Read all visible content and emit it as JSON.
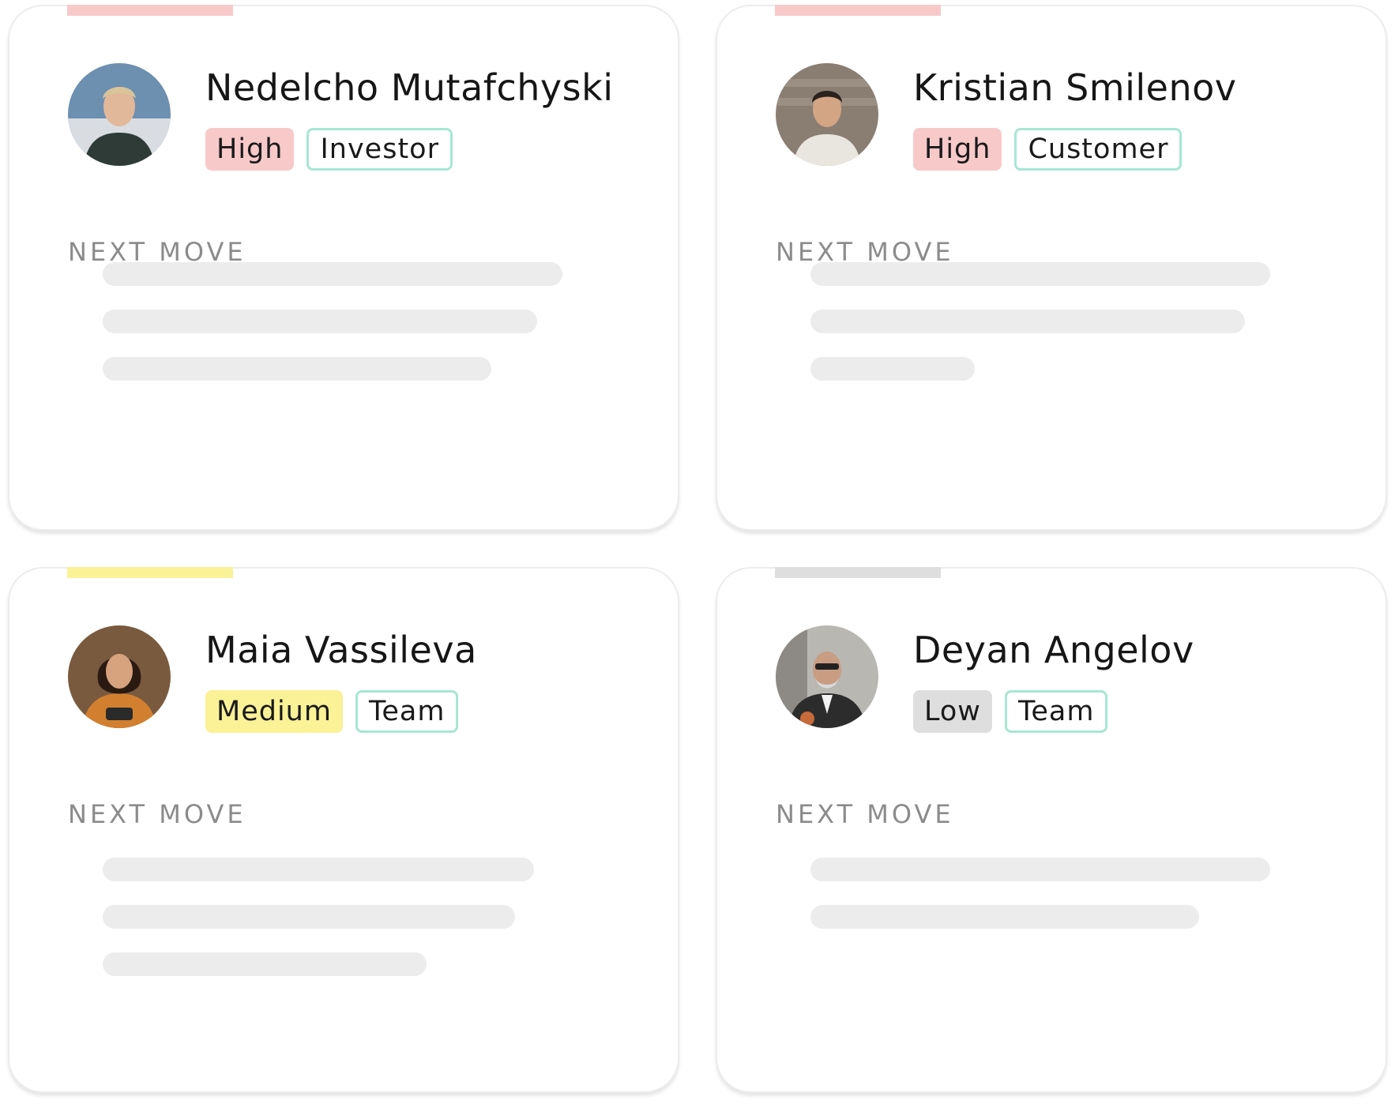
{
  "colors": {
    "priority_high": "#f8c9c9",
    "priority_medium": "#fbf196",
    "priority_low": "#dedede",
    "type_tag_border": "#a8e6d4",
    "skeleton": "#ececec",
    "section_label": "#8b8b8b"
  },
  "cards": [
    {
      "name": "Nedelcho Mutafchyski",
      "priority": "High",
      "type": "Investor",
      "section_label": "NEXT MOVE",
      "avatar": "person-photo"
    },
    {
      "name": "Kristian Smilenov",
      "priority": "High",
      "type": "Customer",
      "section_label": "NEXT MOVE",
      "avatar": "person-photo"
    },
    {
      "name": "Maia Vassileva",
      "priority": "Medium",
      "type": "Team",
      "section_label": "NEXT MOVE",
      "avatar": "person-photo"
    },
    {
      "name": "Deyan Angelov",
      "priority": "Low",
      "type": "Team",
      "section_label": "NEXT MOVE",
      "avatar": "person-photo"
    }
  ]
}
